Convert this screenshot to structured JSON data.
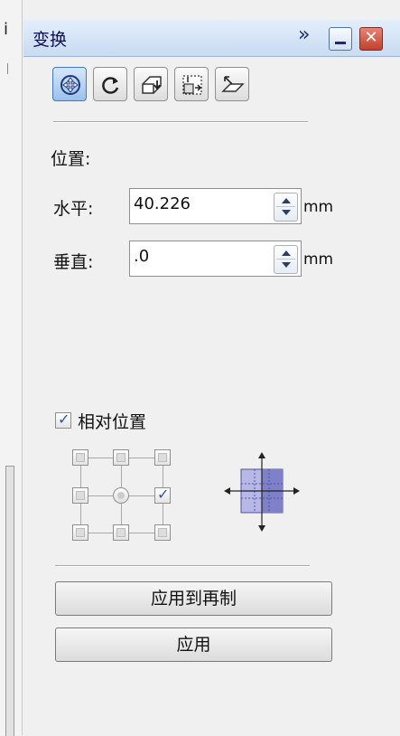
{
  "left_panel": {
    "cut_text": "i"
  },
  "panel": {
    "title": "变换",
    "expand_glyph": "»",
    "close_glyph": "✕"
  },
  "toolbar": {
    "items": [
      {
        "name": "position",
        "icon": "position-icon",
        "active": true
      },
      {
        "name": "rotate",
        "icon": "rotate-icon",
        "active": false
      },
      {
        "name": "scale",
        "icon": "scale-mirror-icon",
        "active": false
      },
      {
        "name": "size",
        "icon": "size-icon",
        "active": false
      },
      {
        "name": "skew",
        "icon": "skew-icon",
        "active": false
      }
    ]
  },
  "position": {
    "section_label": "位置:",
    "horizontal": {
      "label": "水平:",
      "value": "40.226",
      "unit": "mm"
    },
    "vertical": {
      "label": "垂直:",
      "value": ".0",
      "unit": "mm"
    }
  },
  "relative": {
    "label": "相对位置",
    "checked": true,
    "anchor_checked": "middle-right"
  },
  "buttons": {
    "apply_copy": "应用到再制",
    "apply": "应用"
  },
  "colors": {
    "title_bar": "#c8dbf2",
    "accent": "#3d7bbd",
    "check": "#2b52b5",
    "anchor_preview": "#8080c8"
  }
}
